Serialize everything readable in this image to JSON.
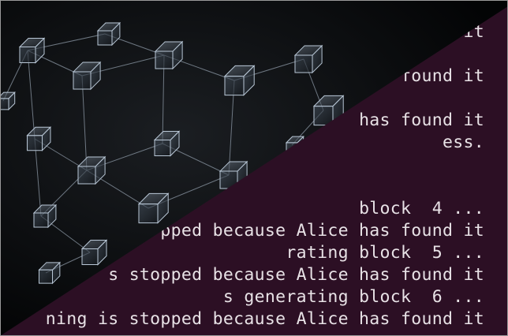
{
  "terminal": {
    "lines": [
      "it",
      "found it",
      "has found it",
      "ess.",
      "block  4 ...",
      "pped because Alice has found it",
      "rating block  5 ...",
      "s stopped because Alice has found it",
      "s generating block  6 ...",
      "ning is stopped because Alice has found it"
    ]
  },
  "colors": {
    "terminal_bg": "#2c0f24",
    "terminal_text": "#e8e2e6",
    "network_bg": "#050607",
    "cube_edge": "#b9c7d6",
    "link_line": "#8d99a6"
  }
}
